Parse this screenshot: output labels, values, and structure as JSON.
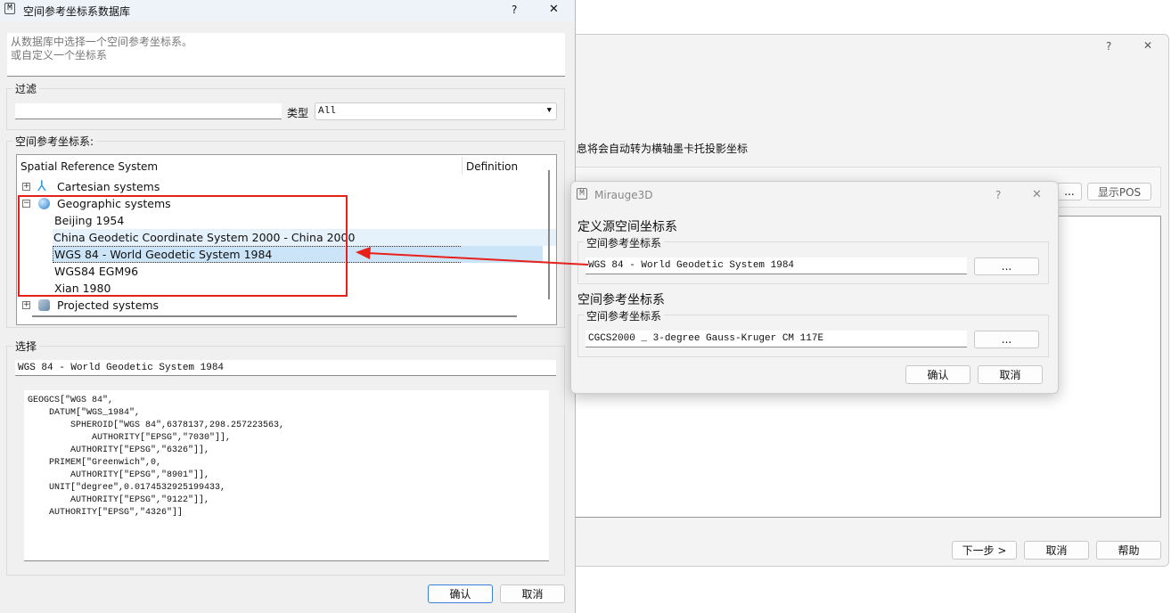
{
  "background_window": {
    "help": "?",
    "close": "✕",
    "info_text": "息将会自动转为横轴墨卡托投影坐标",
    "browse_label": "...",
    "show_pos_label": "显示POS",
    "next_label": "下一步 >",
    "cancel_label": "取消",
    "help_label": "帮助"
  },
  "srs_dialog": {
    "icon": "M",
    "title": "空间参考坐标系数据库",
    "help": "?",
    "close": "✕",
    "description": [
      "从数据库中选择一个空间参考坐标系。",
      "或自定义一个坐标系"
    ],
    "filter": {
      "group_label": "过滤",
      "value": "",
      "type_label": "类型",
      "type_value": "All"
    },
    "tree": {
      "group_label": "空间参考坐标系:",
      "columns": [
        "Spatial Reference System",
        "Definition"
      ],
      "nodes": [
        {
          "label": "Cartesian systems",
          "icon": "axes-icon",
          "expanded": false
        },
        {
          "label": "Geographic systems",
          "icon": "globe-icon",
          "expanded": true,
          "children": [
            "Beijing 1954",
            "China Geodetic Coordinate System 2000 - China 2000",
            "WGS 84 - World Geodetic System 1984",
            "WGS84 EGM96",
            "Xian 1980"
          ]
        },
        {
          "label": "Projected systems",
          "icon": "projected-globe-icon",
          "expanded": false
        }
      ],
      "selected": "WGS 84 - World Geodetic System 1984"
    },
    "selection": {
      "group_label": "选择",
      "value": "WGS 84 - World Geodetic System 1984",
      "wkt": "GEOGCS[\"WGS 84\",\n    DATUM[\"WGS_1984\",\n        SPHEROID[\"WGS 84\",6378137,298.257223563,\n            AUTHORITY[\"EPSG\",\"7030\"]],\n        AUTHORITY[\"EPSG\",\"6326\"]],\n    PRIMEM[\"Greenwich\",0,\n        AUTHORITY[\"EPSG\",\"8901\"]],\n    UNIT[\"degree\",0.0174532925199433,\n        AUTHORITY[\"EPSG\",\"9122\"]],\n    AUTHORITY[\"EPSG\",\"4326\"]]"
    },
    "ok_label": "确认",
    "cancel_label": "取消"
  },
  "mirauge_dialog": {
    "icon": "M",
    "title": "Mirauge3D",
    "help": "?",
    "close": "✕",
    "source_heading": "定义源空间坐标系",
    "source_group": "空间参考坐标系",
    "source_value": "WGS 84 - World Geodetic System 1984",
    "target_heading": "空间参考坐标系",
    "target_group": "空间参考坐标系",
    "target_value": "CGCS2000 _ 3-degree Gauss-Kruger CM 117E",
    "browse_label": "...",
    "ok_label": "确认",
    "cancel_label": "取消"
  },
  "annotation": {
    "color": "#e8201c"
  }
}
